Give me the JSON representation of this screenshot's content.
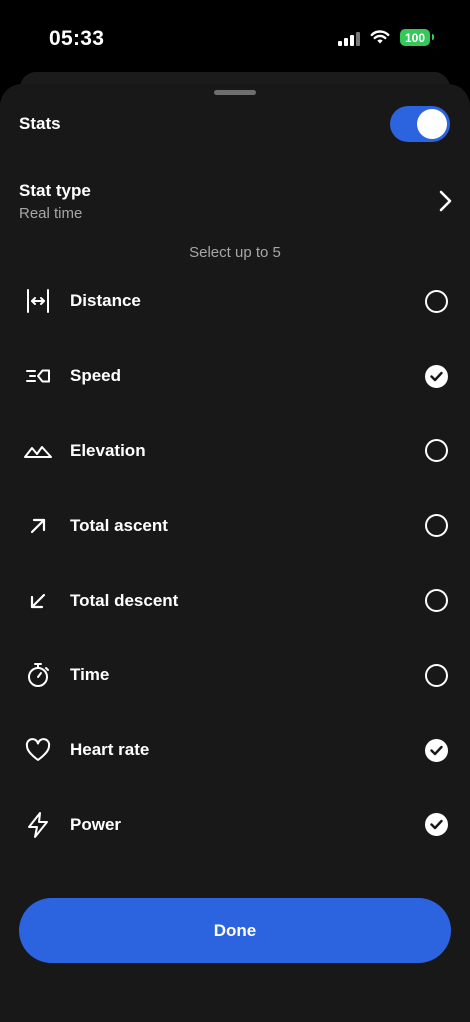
{
  "status_bar": {
    "time": "05:33",
    "battery": "100",
    "icons": [
      "cellular-signal-icon",
      "wifi-icon",
      "battery-icon"
    ]
  },
  "stats": {
    "label": "Stats",
    "enabled": true,
    "accent_color": "#2c63de"
  },
  "stat_type": {
    "title": "Stat type",
    "value": "Real time"
  },
  "hint": "Select up to 5",
  "items": [
    {
      "label": "Distance",
      "icon": "distance-icon",
      "checked": false
    },
    {
      "label": "Speed",
      "icon": "speed-icon",
      "checked": true
    },
    {
      "label": "Elevation",
      "icon": "elevation-icon",
      "checked": false
    },
    {
      "label": "Total ascent",
      "icon": "arrow-up-right-icon",
      "checked": false
    },
    {
      "label": "Total descent",
      "icon": "arrow-down-left-icon",
      "checked": false
    },
    {
      "label": "Time",
      "icon": "stopwatch-icon",
      "checked": false
    },
    {
      "label": "Heart rate",
      "icon": "heart-icon",
      "checked": true
    },
    {
      "label": "Power",
      "icon": "lightning-icon",
      "checked": true
    }
  ],
  "done_label": "Done"
}
